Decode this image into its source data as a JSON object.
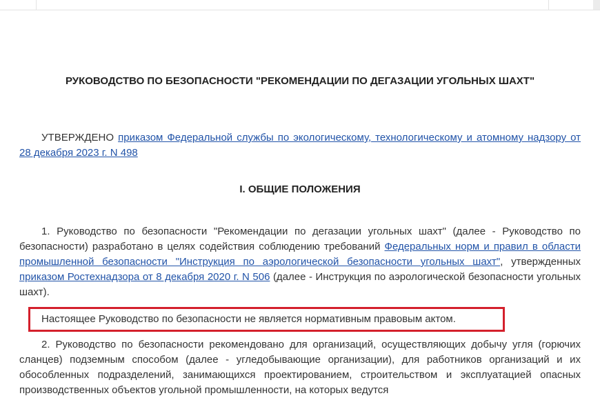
{
  "document": {
    "title": "РУКОВОДСТВО ПО БЕЗОПАСНОСТИ \"РЕКОМЕНДАЦИИ ПО ДЕГАЗАЦИИ УГОЛЬНЫХ ШАХТ\"",
    "approved": {
      "prefix": "УТВЕРЖДЕНО ",
      "link": "приказом Федеральной службы по экологическому, технологическому и атомному надзору от 28 декабря 2023 г. N 498"
    },
    "section_title": "I. ОБЩИЕ ПОЛОЖЕНИЯ",
    "paragraph1": {
      "text_a": "1. Руководство по безопасности \"Рекомендации по дегазации угольных шахт\" (далее - Руководство по безопасности) разработано в целях содействия соблюдению требований ",
      "link_a": "Федеральных норм и правил в области промышленной безопасности \"Инструкция по аэрологической безопасности угольных шахт\"",
      "text_b": ", утвержденных ",
      "link_b": "приказом Ростехнадзора от 8 декабря 2020 г. N 506",
      "text_c": " (далее - Инструкция по аэрологической безопасности угольных шахт)."
    },
    "notice": "Настоящее Руководство по безопасности не является нормативным правовым актом.",
    "paragraph2": "2. Руководство по безопасности рекомендовано для организаций, осуществляющих добычу угля (горючих сланцев) подземным способом (далее - угледобывающие организации), для работников организаций и их обособленных подразделений, занимающихся проектированием, строительством и эксплуатацией опасных производственных объектов угольной промышленности, на которых ведутся"
  },
  "colors": {
    "text": "#333333",
    "link": "#2153a8",
    "highlight_border": "#d4202c"
  }
}
